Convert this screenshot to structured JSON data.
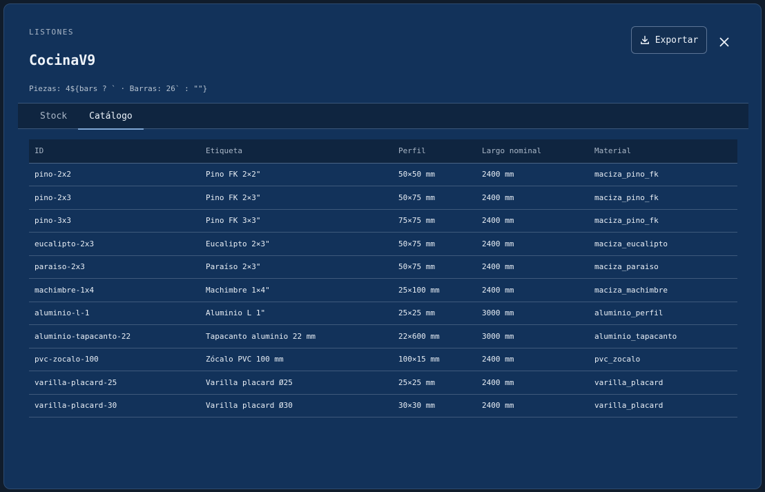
{
  "header": {
    "eyebrow": "LISTONES",
    "title": "CocinaV9",
    "summary": "Piezas: 4${bars ? ` · Barras: 26` : \"\"}"
  },
  "actions": {
    "export_label": "Exportar",
    "export_icon": "download-icon",
    "close_icon": "close-icon"
  },
  "tabs": [
    {
      "label": "Stock",
      "active": false
    },
    {
      "label": "Catálogo",
      "active": true
    }
  ],
  "table": {
    "columns": [
      "ID",
      "Etiqueta",
      "Perfil",
      "Largo nominal",
      "Material"
    ],
    "rows": [
      [
        "pino-2x2",
        "Pino FK 2×2\"",
        "50×50 mm",
        "2400 mm",
        "maciza_pino_fk"
      ],
      [
        "pino-2x3",
        "Pino FK 2×3\"",
        "50×75 mm",
        "2400 mm",
        "maciza_pino_fk"
      ],
      [
        "pino-3x3",
        "Pino FK 3×3\"",
        "75×75 mm",
        "2400 mm",
        "maciza_pino_fk"
      ],
      [
        "eucalipto-2x3",
        "Eucalipto 2×3\"",
        "50×75 mm",
        "2400 mm",
        "maciza_eucalipto"
      ],
      [
        "paraiso-2x3",
        "Paraíso 2×3\"",
        "50×75 mm",
        "2400 mm",
        "maciza_paraiso"
      ],
      [
        "machimbre-1x4",
        "Machimbre 1×4\"",
        "25×100 mm",
        "2400 mm",
        "maciza_machimbre"
      ],
      [
        "aluminio-l-1",
        "Aluminio L 1\"",
        "25×25 mm",
        "3000 mm",
        "aluminio_perfil"
      ],
      [
        "aluminio-tapacanto-22",
        "Tapacanto aluminio 22 mm",
        "22×600 mm",
        "3000 mm",
        "aluminio_tapacanto"
      ],
      [
        "pvc-zocalo-100",
        "Zócalo PVC 100 mm",
        "100×15 mm",
        "2400 mm",
        "pvc_zocalo"
      ],
      [
        "varilla-placard-25",
        "Varilla placard Ø25",
        "25×25 mm",
        "2400 mm",
        "varilla_placard"
      ],
      [
        "varilla-placard-30",
        "Varilla placard Ø30",
        "30×30 mm",
        "2400 mm",
        "varilla_placard"
      ]
    ]
  },
  "colors": {
    "modal_bg": "#12325a",
    "accent": "#7fa6d4"
  }
}
